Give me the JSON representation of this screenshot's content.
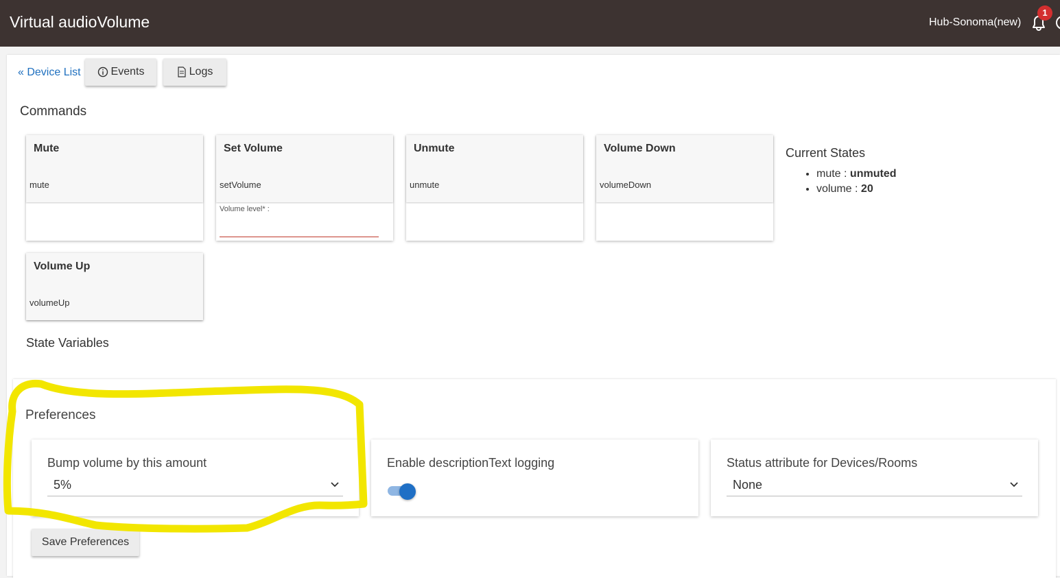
{
  "header": {
    "title": "Virtual audioVolume",
    "hub_name": "Hub-Sonoma(new)",
    "notification_count": "1"
  },
  "nav": {
    "back_label": "« Device List",
    "events_label": "Events",
    "logs_label": "Logs"
  },
  "commands": {
    "title": "Commands",
    "items": [
      {
        "label": "Mute",
        "method": "mute"
      },
      {
        "label": "Set Volume",
        "method": "setVolume",
        "param_label": "Volume level* :",
        "param_value": ""
      },
      {
        "label": "Unmute",
        "method": "unmute"
      },
      {
        "label": "Volume Down",
        "method": "volumeDown"
      },
      {
        "label": "Volume Up",
        "method": "volumeUp"
      }
    ]
  },
  "current_states": {
    "title": "Current States",
    "items": [
      {
        "name": "mute",
        "sep": " : ",
        "value": "unmuted"
      },
      {
        "name": "volume",
        "sep": " : ",
        "value": "20"
      }
    ]
  },
  "state_variables": {
    "title": "State Variables"
  },
  "preferences": {
    "title": "Preferences",
    "bump": {
      "label": "Bump volume by this amount",
      "value": "5%"
    },
    "logging": {
      "label": "Enable descriptionText logging",
      "enabled": true
    },
    "status_attr": {
      "label": "Status attribute for Devices/Rooms",
      "value": "None"
    },
    "save_label": "Save Preferences"
  },
  "colors": {
    "header_bg": "#3d3331",
    "link": "#1e6fbf",
    "toggle_on": "#1f6fc5",
    "badge": "#d32f2f",
    "annotation": "#f2e600"
  },
  "icons": {
    "events": "info-icon",
    "logs": "document-icon",
    "notifications": "bell-icon"
  }
}
